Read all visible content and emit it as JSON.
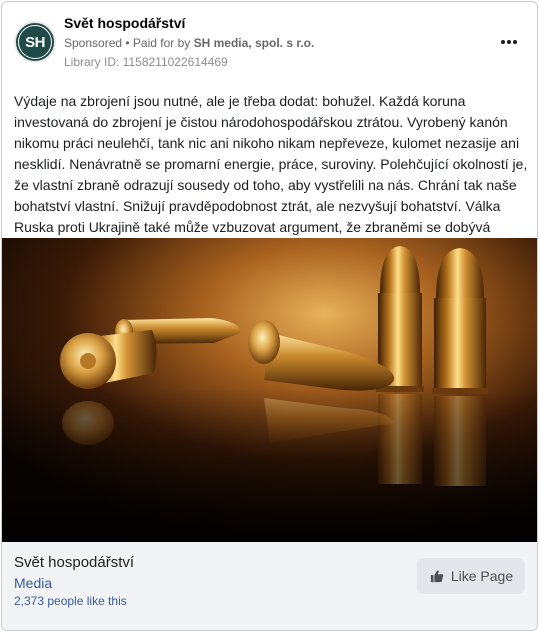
{
  "header": {
    "page_name": "Svět hospodářství",
    "avatar_text": "SH",
    "sponsored": "Sponsored",
    "paid_for_prefix": " • Paid for by ",
    "paid_for_by": "SH media, spol. s r.o.",
    "library_id": "Library ID: 1158211022614469",
    "more_icon": "more-horizontal-icon"
  },
  "post": {
    "text": "Výdaje na zbrojení jsou nutné, ale je třeba dodat: bohužel. Každá koruna investovaná do zbrojení je čistou národohospodářskou ztrátou. Vyrobený kanón nikomu práci neulehčí, tank nic ani nikoho nikam nepřeveze, kulomet nezasije ani nesklidí. Nenávratně se promarní energie, práce, suroviny. Polehčující okolností je, že vlastní zbraně odrazují sousedy od toho, aby vystřelili na nás. Chrání tak naše bohatství vlastní. Snižují pravděpodobnost ztrát, ale nezvyšují bohatství. Válka Ruska proti Ukrajině také může vzbuzovat argument, že zbraněmi se dobývá cizí…"
  },
  "image": {
    "subject": "bullets-photo"
  },
  "footer": {
    "title": "Svět hospodářství",
    "category": "Media",
    "likes": "2,373 people like this",
    "like_button": "Like Page",
    "like_icon": "thumbs-up-icon"
  },
  "colors": {
    "avatar_bg": "#1f4a48",
    "link": "#385898",
    "footer_bg": "#f2f3f5",
    "button_bg": "#e4e6eb"
  }
}
